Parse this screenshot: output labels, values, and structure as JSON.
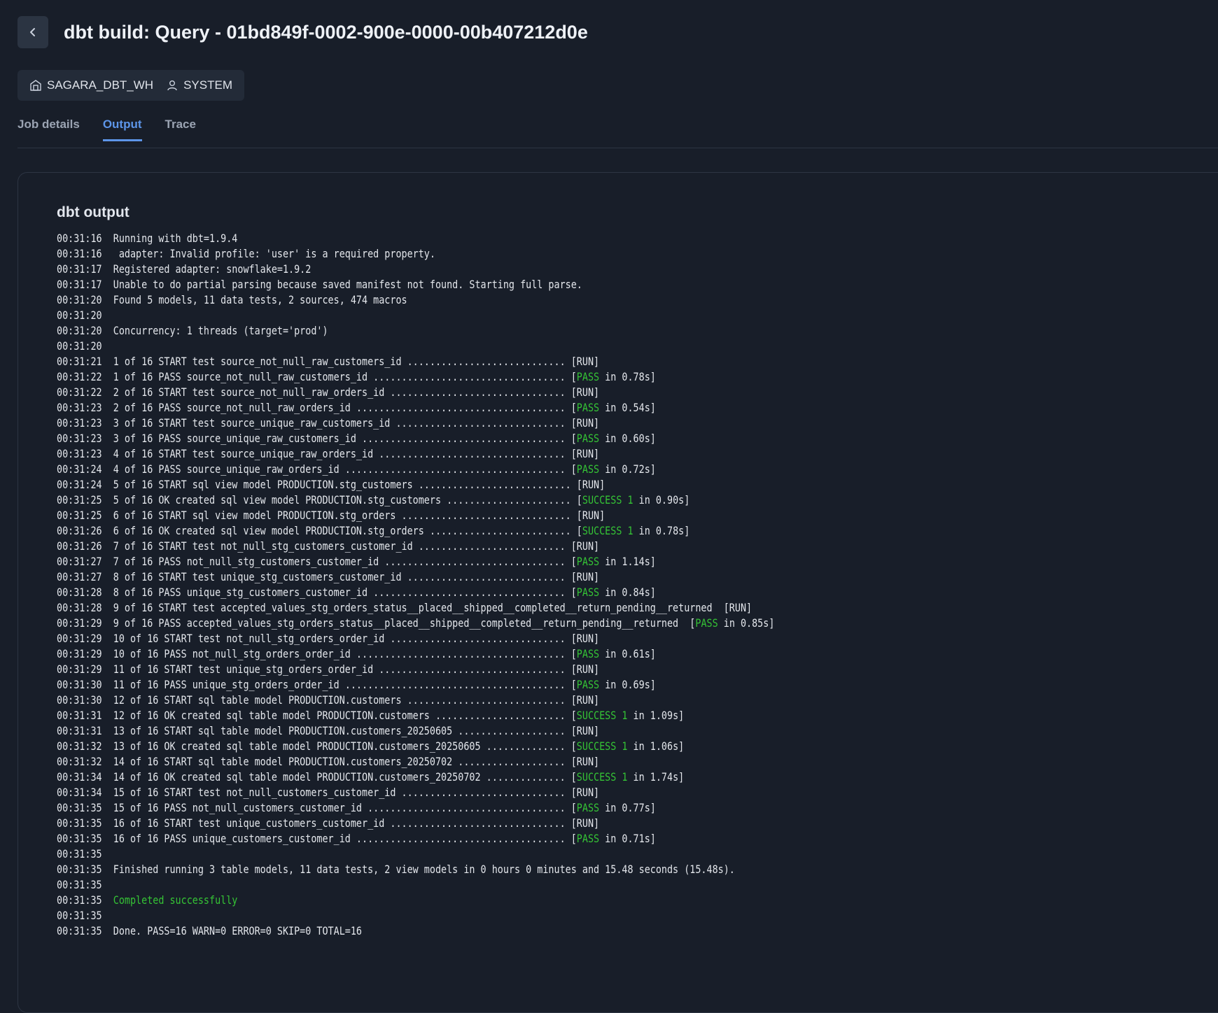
{
  "header": {
    "title": "dbt build: Query - 01bd849f-0002-900e-0000-00b407212d0e"
  },
  "meta": {
    "warehouse": "SAGARA_DBT_WH",
    "user": "SYSTEM"
  },
  "tabs": [
    {
      "label": "Job details",
      "active": false
    },
    {
      "label": "Output",
      "active": true
    },
    {
      "label": "Trace",
      "active": false
    }
  ],
  "colors": {
    "accent": "#5d95e8",
    "success": "#35c435",
    "background": "#181e29"
  },
  "output": {
    "title": "dbt output",
    "lines": [
      {
        "time": "00:31:16",
        "text": "Running with dbt=1.9.4"
      },
      {
        "time": "00:31:16",
        "text": " adapter: Invalid profile: 'user' is a required property."
      },
      {
        "time": "00:31:17",
        "text": "Registered adapter: snowflake=1.9.2"
      },
      {
        "time": "00:31:17",
        "text": "Unable to do partial parsing because saved manifest not found. Starting full parse."
      },
      {
        "time": "00:31:20",
        "text": "Found 5 models, 11 data tests, 2 sources, 474 macros"
      },
      {
        "time": "00:31:20",
        "text": ""
      },
      {
        "time": "00:31:20",
        "text": "Concurrency: 1 threads (target='prod')"
      },
      {
        "time": "00:31:20",
        "text": ""
      },
      {
        "time": "00:31:21",
        "text": "1 of 16 START test source_not_null_raw_customers_id ............................ [RUN]"
      },
      {
        "time": "00:31:22",
        "text": "1 of 16 PASS source_not_null_raw_customers_id .................................. [",
        "status": "PASS",
        "rest": " in 0.78s]"
      },
      {
        "time": "00:31:22",
        "text": "2 of 16 START test source_not_null_raw_orders_id ............................... [RUN]"
      },
      {
        "time": "00:31:23",
        "text": "2 of 16 PASS source_not_null_raw_orders_id ..................................... [",
        "status": "PASS",
        "rest": " in 0.54s]"
      },
      {
        "time": "00:31:23",
        "text": "3 of 16 START test source_unique_raw_customers_id .............................. [RUN]"
      },
      {
        "time": "00:31:23",
        "text": "3 of 16 PASS source_unique_raw_customers_id .................................... [",
        "status": "PASS",
        "rest": " in 0.60s]"
      },
      {
        "time": "00:31:23",
        "text": "4 of 16 START test source_unique_raw_orders_id ................................. [RUN]"
      },
      {
        "time": "00:31:24",
        "text": "4 of 16 PASS source_unique_raw_orders_id ....................................... [",
        "status": "PASS",
        "rest": " in 0.72s]"
      },
      {
        "time": "00:31:24",
        "text": "5 of 16 START sql view model PRODUCTION.stg_customers ........................... [RUN]"
      },
      {
        "time": "00:31:25",
        "text": "5 of 16 OK created sql view model PRODUCTION.stg_customers ...................... [",
        "status": "SUCCESS 1",
        "rest": " in 0.90s]"
      },
      {
        "time": "00:31:25",
        "text": "6 of 16 START sql view model PRODUCTION.stg_orders .............................. [RUN]"
      },
      {
        "time": "00:31:26",
        "text": "6 of 16 OK created sql view model PRODUCTION.stg_orders ......................... [",
        "status": "SUCCESS 1",
        "rest": " in 0.78s]"
      },
      {
        "time": "00:31:26",
        "text": "7 of 16 START test not_null_stg_customers_customer_id .......................... [RUN]"
      },
      {
        "time": "00:31:27",
        "text": "7 of 16 PASS not_null_stg_customers_customer_id ................................ [",
        "status": "PASS",
        "rest": " in 1.14s]"
      },
      {
        "time": "00:31:27",
        "text": "8 of 16 START test unique_stg_customers_customer_id ............................ [RUN]"
      },
      {
        "time": "00:31:28",
        "text": "8 of 16 PASS unique_stg_customers_customer_id .................................. [",
        "status": "PASS",
        "rest": " in 0.84s]"
      },
      {
        "time": "00:31:28",
        "text": "9 of 16 START test accepted_values_stg_orders_status__placed__shipped__completed__return_pending__returned  [RUN]"
      },
      {
        "time": "00:31:29",
        "text": "9 of 16 PASS accepted_values_stg_orders_status__placed__shipped__completed__return_pending__returned  [",
        "status": "PASS",
        "rest": " in 0.85s]"
      },
      {
        "time": "00:31:29",
        "text": "10 of 16 START test not_null_stg_orders_order_id ............................... [RUN]"
      },
      {
        "time": "00:31:29",
        "text": "10 of 16 PASS not_null_stg_orders_order_id ..................................... [",
        "status": "PASS",
        "rest": " in 0.61s]"
      },
      {
        "time": "00:31:29",
        "text": "11 of 16 START test unique_stg_orders_order_id ................................. [RUN]"
      },
      {
        "time": "00:31:30",
        "text": "11 of 16 PASS unique_stg_orders_order_id ....................................... [",
        "status": "PASS",
        "rest": " in 0.69s]"
      },
      {
        "time": "00:31:30",
        "text": "12 of 16 START sql table model PRODUCTION.customers ............................ [RUN]"
      },
      {
        "time": "00:31:31",
        "text": "12 of 16 OK created sql table model PRODUCTION.customers ....................... [",
        "status": "SUCCESS 1",
        "rest": " in 1.09s]"
      },
      {
        "time": "00:31:31",
        "text": "13 of 16 START sql table model PRODUCTION.customers_20250605 ................... [RUN]"
      },
      {
        "time": "00:31:32",
        "text": "13 of 16 OK created sql table model PRODUCTION.customers_20250605 .............. [",
        "status": "SUCCESS 1",
        "rest": " in 1.06s]"
      },
      {
        "time": "00:31:32",
        "text": "14 of 16 START sql table model PRODUCTION.customers_20250702 ................... [RUN]"
      },
      {
        "time": "00:31:34",
        "text": "14 of 16 OK created sql table model PRODUCTION.customers_20250702 .............. [",
        "status": "SUCCESS 1",
        "rest": " in 1.74s]"
      },
      {
        "time": "00:31:34",
        "text": "15 of 16 START test not_null_customers_customer_id ............................. [RUN]"
      },
      {
        "time": "00:31:35",
        "text": "15 of 16 PASS not_null_customers_customer_id ................................... [",
        "status": "PASS",
        "rest": " in 0.77s]"
      },
      {
        "time": "00:31:35",
        "text": "16 of 16 START test unique_customers_customer_id ............................... [RUN]"
      },
      {
        "time": "00:31:35",
        "text": "16 of 16 PASS unique_customers_customer_id ..................................... [",
        "status": "PASS",
        "rest": " in 0.71s]"
      },
      {
        "time": "00:31:35",
        "text": ""
      },
      {
        "time": "00:31:35",
        "text": "Finished running 3 table models, 11 data tests, 2 view models in 0 hours 0 minutes and 15.48 seconds (15.48s)."
      },
      {
        "time": "00:31:35",
        "text": ""
      },
      {
        "time": "00:31:35",
        "text": "",
        "status": "Completed successfully"
      },
      {
        "time": "00:31:35",
        "text": ""
      },
      {
        "time": "00:31:35",
        "text": "Done. PASS=16 WARN=0 ERROR=0 SKIP=0 TOTAL=16"
      }
    ]
  }
}
